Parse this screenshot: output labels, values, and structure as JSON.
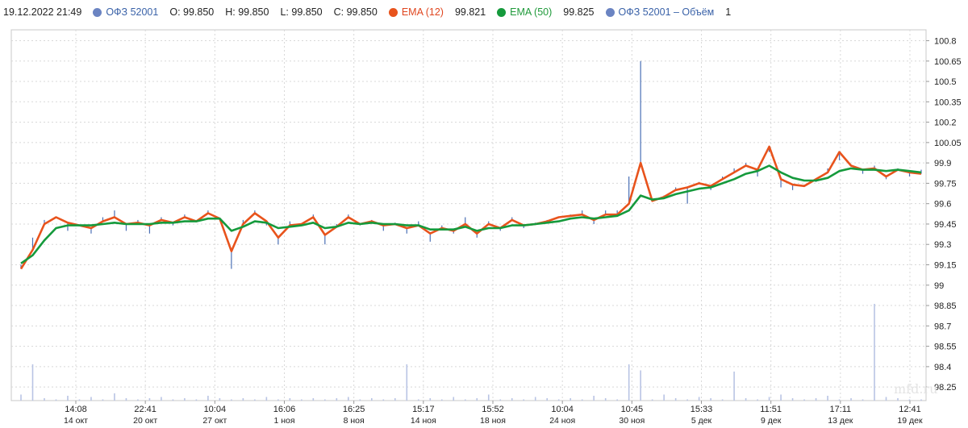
{
  "legend": {
    "date": "19.12.2022 21:49",
    "instrument": "ОФЗ 52001",
    "open": "O: 99.850",
    "high": "H: 99.850",
    "low": "L: 99.850",
    "close": "C: 99.850",
    "ema12_label": "EMA (12)",
    "ema12_value": "99.821",
    "ema50_label": "EMA (50)",
    "ema50_value": "99.825",
    "volume_label": "ОФЗ 52001 – Объём",
    "volume_value": "1"
  },
  "colors": {
    "price": "#4a6fb5",
    "ema12": "#e8531c",
    "ema50": "#159a3c",
    "volume": "#b9c4e4",
    "grid": "#d8d8d8"
  },
  "watermark": "mfd.ru",
  "chart_data": {
    "type": "line",
    "ylim": [
      98.15,
      100.88
    ],
    "yticks": [
      100.8,
      100.65,
      100.5,
      100.35,
      100.2,
      100.05,
      99.9,
      99.75,
      99.6,
      99.45,
      99.3,
      99.15,
      99,
      98.85,
      98.7,
      98.55,
      98.4,
      98.25
    ],
    "ytick_labels": [
      "100.8",
      "100.65",
      "100.5",
      "100.35",
      "100.2",
      "100.05",
      "99.9",
      "99.75",
      "99.6",
      "99.45",
      "99.3",
      "99.15",
      "99",
      "98.85",
      "98.7",
      "98.55",
      "98.4",
      "98.25"
    ],
    "x_times": [
      "14:08",
      "22:41",
      "10:04",
      "16:06",
      "16:25",
      "15:17",
      "15:52",
      "10:04",
      "10:45",
      "15:33",
      "11:51",
      "17:11",
      "12:41"
    ],
    "x_dates": [
      "14 окт",
      "20 окт",
      "27 окт",
      "1 ноя",
      "8 ноя",
      "14 ноя",
      "18 ноя",
      "24 ноя",
      "30 ноя",
      "5 дек",
      "9 дек",
      "13 дек",
      "19 дек"
    ],
    "series": [
      {
        "name": "EMA (12)",
        "values": [
          99.12,
          99.26,
          99.45,
          99.5,
          99.46,
          99.44,
          99.42,
          99.47,
          99.5,
          99.45,
          99.46,
          99.44,
          99.48,
          99.46,
          99.5,
          99.47,
          99.53,
          99.49,
          99.25,
          99.45,
          99.53,
          99.47,
          99.35,
          99.44,
          99.45,
          99.5,
          99.37,
          99.43,
          99.5,
          99.45,
          99.47,
          99.44,
          99.45,
          99.42,
          99.44,
          99.38,
          99.42,
          99.4,
          99.45,
          99.38,
          99.45,
          99.42,
          99.48,
          99.44,
          99.45,
          99.47,
          99.5,
          99.51,
          99.52,
          99.48,
          99.52,
          99.52,
          99.6,
          99.9,
          99.62,
          99.65,
          99.7,
          99.72,
          99.75,
          99.73,
          99.78,
          99.83,
          99.88,
          99.85,
          100.02,
          99.78,
          99.74,
          99.73,
          99.78,
          99.83,
          99.98,
          99.88,
          99.85,
          99.86,
          99.8,
          99.85,
          99.83,
          99.82
        ]
      },
      {
        "name": "EMA (50)",
        "values": [
          99.16,
          99.22,
          99.33,
          99.42,
          99.44,
          99.44,
          99.44,
          99.45,
          99.46,
          99.45,
          99.45,
          99.45,
          99.46,
          99.46,
          99.47,
          99.47,
          99.49,
          99.49,
          99.4,
          99.43,
          99.47,
          99.46,
          99.42,
          99.43,
          99.44,
          99.46,
          99.42,
          99.43,
          99.46,
          99.45,
          99.46,
          99.45,
          99.45,
          99.44,
          99.44,
          99.41,
          99.41,
          99.41,
          99.43,
          99.4,
          99.42,
          99.42,
          99.44,
          99.44,
          99.45,
          99.46,
          99.47,
          99.49,
          99.5,
          99.49,
          99.5,
          99.51,
          99.55,
          99.66,
          99.63,
          99.64,
          99.67,
          99.69,
          99.71,
          99.72,
          99.75,
          99.78,
          99.82,
          99.84,
          99.88,
          99.83,
          99.79,
          99.77,
          99.77,
          99.79,
          99.84,
          99.86,
          99.85,
          99.85,
          99.84,
          99.85,
          99.84,
          99.83
        ]
      },
      {
        "name": "ОФЗ 52001",
        "values": [
          99.15,
          99.35,
          99.48,
          99.5,
          99.4,
          99.44,
          99.38,
          99.5,
          99.55,
          99.4,
          99.48,
          99.38,
          99.5,
          99.44,
          99.52,
          99.47,
          99.55,
          99.48,
          99.12,
          99.48,
          99.55,
          99.44,
          99.3,
          99.47,
          99.45,
          99.52,
          99.3,
          99.45,
          99.52,
          99.44,
          99.48,
          99.4,
          99.46,
          99.38,
          99.47,
          99.32,
          99.44,
          99.38,
          99.5,
          99.35,
          99.47,
          99.4,
          99.5,
          99.42,
          99.46,
          99.48,
          99.5,
          99.52,
          99.55,
          99.45,
          99.55,
          99.55,
          99.8,
          100.65,
          99.62,
          99.66,
          99.72,
          99.6,
          99.76,
          99.7,
          99.8,
          99.86,
          99.9,
          99.8,
          99.98,
          99.72,
          99.7,
          99.74,
          99.76,
          99.86,
          99.92,
          99.88,
          99.82,
          99.88,
          99.78,
          99.86,
          99.8,
          99.85
        ]
      },
      {
        "name": "ОФЗ 52001 – Объём",
        "values": [
          0.05,
          0.3,
          0.02,
          0.01,
          0.04,
          0.01,
          0.03,
          0.01,
          0.06,
          0.02,
          0.01,
          0.02,
          0.03,
          0.01,
          0.02,
          0.01,
          0.04,
          0.02,
          0.01,
          0.02,
          0.01,
          0.03,
          0.01,
          0.02,
          0.01,
          0.02,
          0.01,
          0.02,
          0.03,
          0.01,
          0.02,
          0.01,
          0.02,
          0.3,
          0.01,
          0.02,
          0.01,
          0.03,
          0.01,
          0.02,
          0.05,
          0.01,
          0.02,
          0.01,
          0.03,
          0.02,
          0.01,
          0.02,
          0.01,
          0.04,
          0.02,
          0.01,
          0.3,
          0.25,
          0.01,
          0.05,
          0.02,
          0.01,
          0.03,
          0.02,
          0.01,
          0.24,
          0.02,
          0.01,
          0.03,
          0.05,
          0.02,
          0.01,
          0.02,
          0.04,
          0.01,
          0.02,
          0.01,
          0.8,
          0.03,
          0.02,
          0.01,
          0.01
        ]
      }
    ]
  }
}
